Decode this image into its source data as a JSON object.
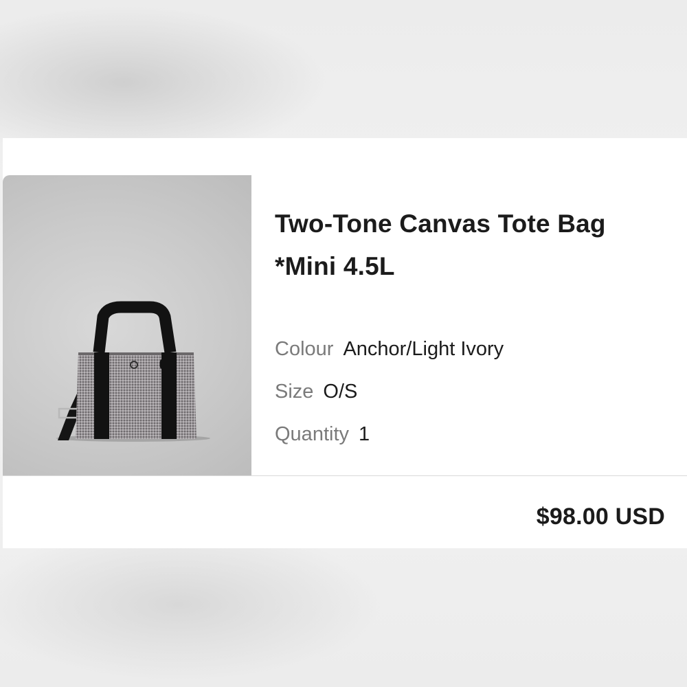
{
  "product": {
    "title_line1": "Two-Tone Canvas Tote Bag",
    "title_line2": "*Mini 4.5L",
    "image_icon": "tote-bag-icon",
    "attributes": [
      {
        "label": "Colour",
        "value": "Anchor/Light Ivory"
      },
      {
        "label": "Size",
        "value": "O/S"
      },
      {
        "label": "Quantity",
        "value": "1"
      }
    ]
  },
  "price": "$98.00 USD",
  "colors": {
    "text": "#1b1b1b",
    "label": "#7a7a7a",
    "card": "#ffffff",
    "bag_body": "#8e8a8d",
    "bag_straps": "#111111"
  }
}
